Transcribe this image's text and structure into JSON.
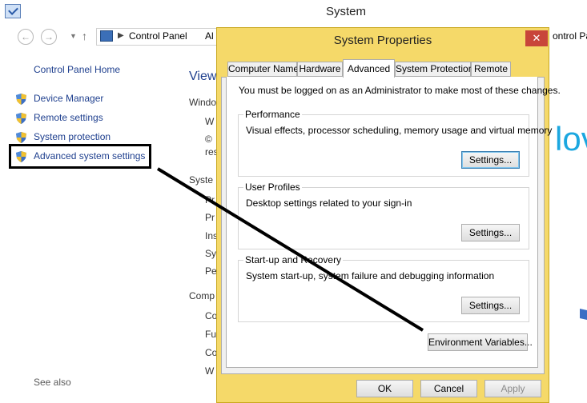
{
  "window": {
    "title": "System",
    "address": {
      "crumb": "Control Panel",
      "crumb_cut": "Al",
      "right_cut": "ontrol Panel"
    }
  },
  "left_pane": {
    "home_link": "Control Panel Home",
    "items": [
      {
        "label": "Device Manager"
      },
      {
        "label": "Remote settings"
      },
      {
        "label": "System protection"
      },
      {
        "label": "Advanced system settings"
      }
    ],
    "see_also": "See also"
  },
  "background_content": {
    "view_title": "View",
    "windows_cut": "Windo",
    "system_cut": "Syste",
    "computer_cut": "Comp",
    "big_cut": "lov",
    "small_cuts": [
      "W",
      "©",
      "res",
      "Pr",
      "Pr",
      "Ins",
      "Sy",
      "Pe",
      "Co",
      "Fu",
      "Co",
      "W"
    ]
  },
  "dialog": {
    "title": "System Properties",
    "close": "✕",
    "tabs": [
      {
        "label": "Computer Name",
        "active": false
      },
      {
        "label": "Hardware",
        "active": false
      },
      {
        "label": "Advanced",
        "active": true
      },
      {
        "label": "System Protection",
        "active": false
      },
      {
        "label": "Remote",
        "active": false
      }
    ],
    "admin_notice": "You must be logged on as an Administrator to make most of these changes.",
    "groups": {
      "performance": {
        "label": "Performance",
        "desc": "Visual effects, processor scheduling, memory usage and virtual memory",
        "button": "Settings..."
      },
      "user_profiles": {
        "label": "User Profiles",
        "desc": "Desktop settings related to your sign-in",
        "button": "Settings..."
      },
      "startup": {
        "label": "Start-up and Recovery",
        "desc": "System start-up, system failure and debugging information",
        "button": "Settings..."
      }
    },
    "env_button": "Environment Variables...",
    "ok": "OK",
    "cancel": "Cancel",
    "apply": "Apply"
  },
  "colors": {
    "dialog_frame": "#f5d969",
    "link": "#1e3f8e",
    "close_red": "#c8453a",
    "accent_blue": "#1ba7e0"
  }
}
